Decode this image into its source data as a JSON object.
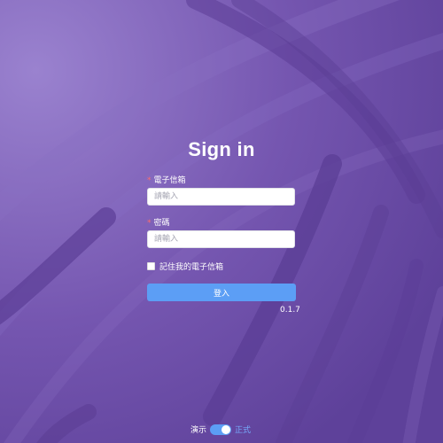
{
  "login": {
    "title": "Sign in",
    "email_label": "電子信箱",
    "email_placeholder": "請輸入",
    "password_label": "密碼",
    "password_placeholder": "請輸入",
    "remember_label": "記住我的電子信箱",
    "login_button": "登入",
    "version": "0.1.7"
  },
  "mode_switch": {
    "left_label": "演示",
    "right_label": "正式"
  },
  "colors": {
    "background": "#6b4fa6",
    "primary": "#5c9ef5",
    "required": "#ff6b6b"
  }
}
